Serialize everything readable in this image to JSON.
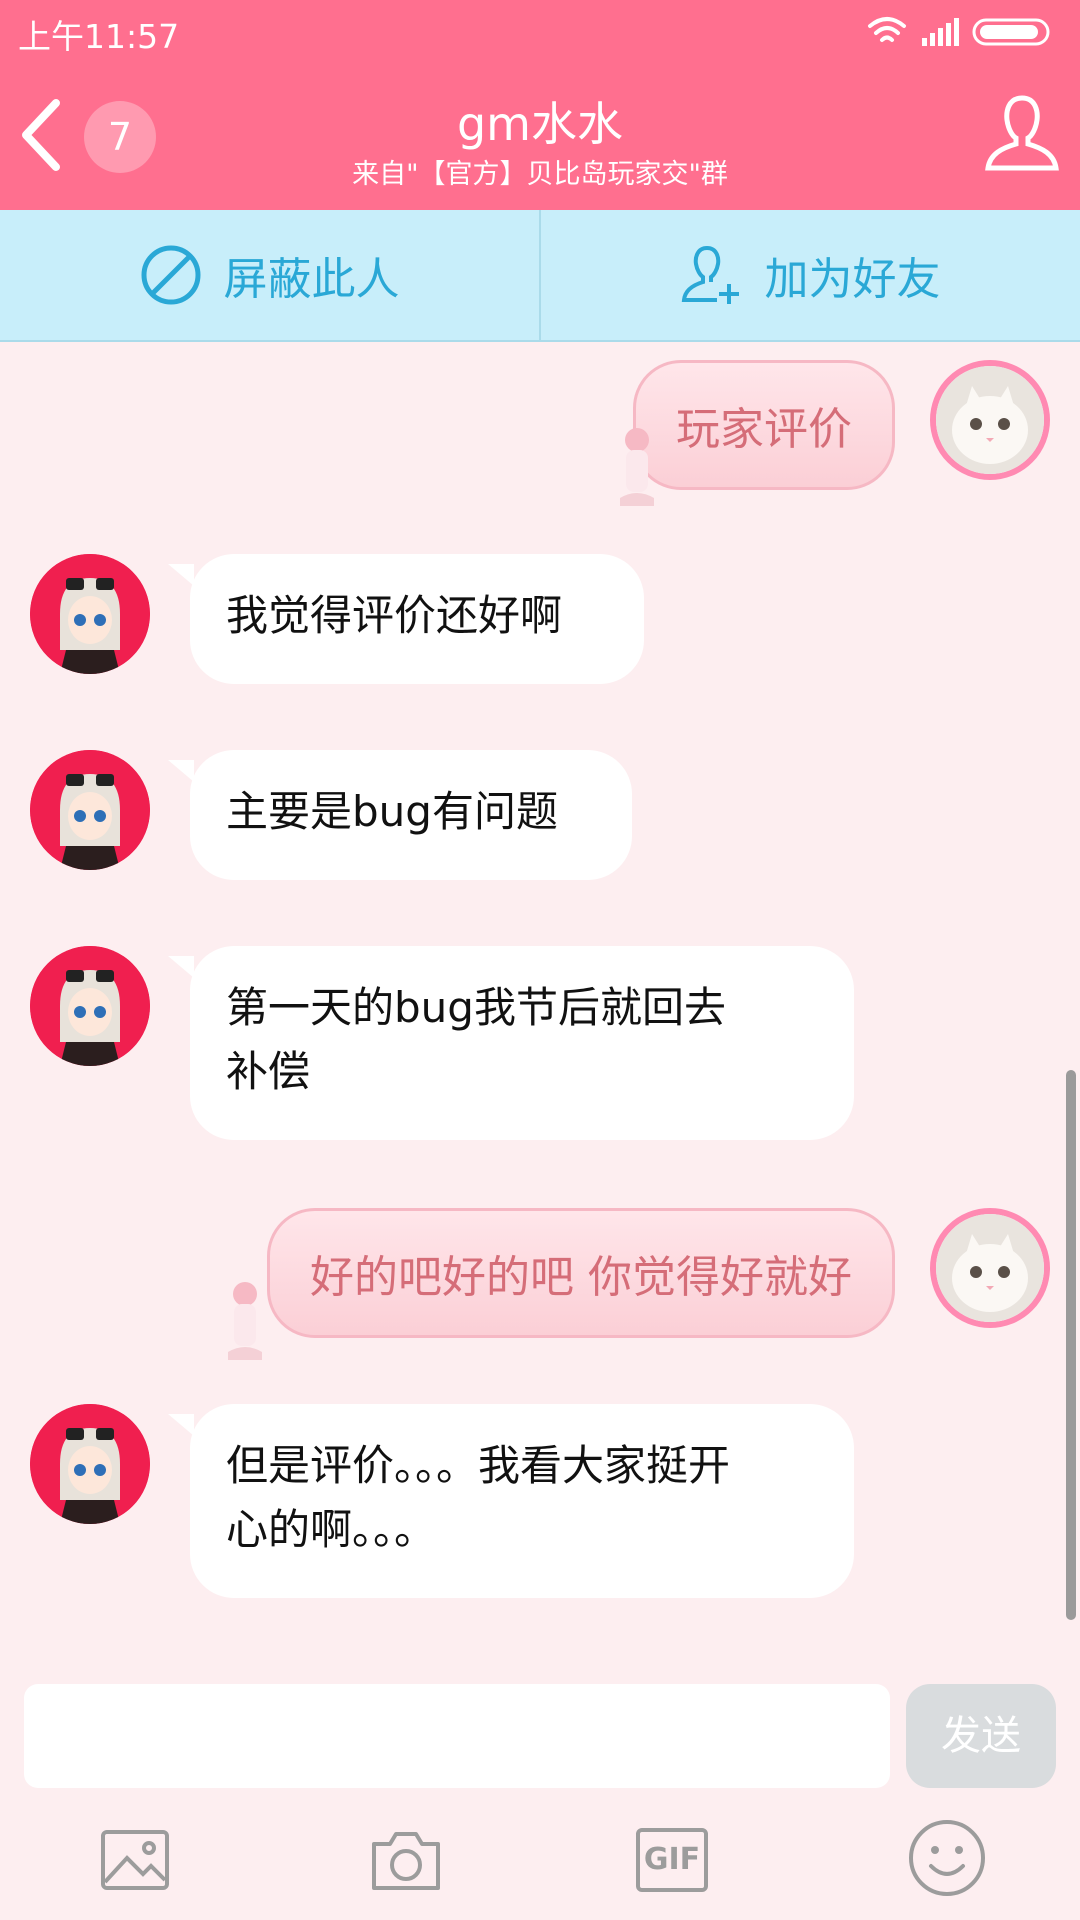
{
  "status_bar": {
    "time": "上午11:57"
  },
  "header": {
    "unread_count": "7",
    "title": "gm水水",
    "subtitle": "来自\"【官方】贝比岛玩家交\"群"
  },
  "actions": {
    "block_label": "屏蔽此人",
    "add_friend_label": "加为好友"
  },
  "messages": [
    {
      "from": "me",
      "text": "玩家评价"
    },
    {
      "from": "other",
      "text": "我觉得评价还好啊"
    },
    {
      "from": "other",
      "text": "主要是bug有问题"
    },
    {
      "from": "other",
      "lines": [
        "第一天的bug我节后就回去",
        "补偿"
      ]
    },
    {
      "from": "me",
      "text": "好的吧好的吧 你觉得好就好"
    },
    {
      "from": "other",
      "lines": [
        "但是评价。。。我看大家挺开",
        "心的啊。。。"
      ]
    }
  ],
  "composer": {
    "input_value": "",
    "send_label": "发送"
  },
  "toolbar": {
    "gif_label": "GIF",
    "items": [
      "image-icon",
      "camera-icon",
      "gif-icon",
      "emoji-icon"
    ]
  },
  "colors": {
    "header_bg": "#ff6f8f",
    "action_bar_bg": "#c8eefa",
    "action_text": "#2aa8d6",
    "chat_bg": "#fdeef0",
    "out_bubble_text": "#d56d78"
  }
}
